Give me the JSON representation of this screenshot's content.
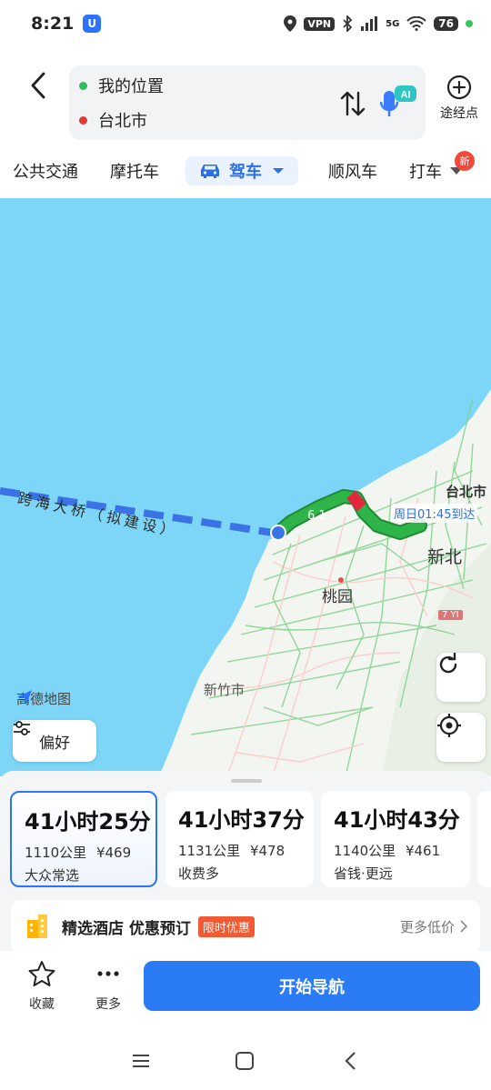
{
  "status_bar": {
    "time": "8:21",
    "app_badge": "U",
    "vpn": "VPN",
    "network": "5G",
    "battery": "76"
  },
  "header": {
    "origin": "我的位置",
    "destination": "台北市",
    "ai_label": "AI",
    "waypoint_label": "途经点"
  },
  "tabs": {
    "items": [
      "公共交通",
      "摩托车",
      "驾车",
      "顺风车",
      "打车"
    ],
    "active": "驾车",
    "new_badge": "新"
  },
  "map": {
    "bridge_label": "跨海大桥（拟建设）",
    "route_number": "6 1",
    "eta": "周日01:45到达",
    "cities": {
      "taipei": "台北市",
      "xinbei": "新北",
      "taoyuan": "桃园",
      "xinzhu": "新竹市"
    },
    "road_sign": "7 YI",
    "logo": "高德地图",
    "preference_button": "偏好",
    "colors": {
      "sea": "#7dd6f7",
      "route": "#2fb44a",
      "route_congested": "#e2283c",
      "bridge": "#3b73e6"
    }
  },
  "routes": [
    {
      "duration": "41小时25分",
      "distance": "1110公里",
      "cost": "¥469",
      "tag": "大众常选",
      "selected": true
    },
    {
      "duration": "41小时37分",
      "distance": "1131公里",
      "cost": "¥478",
      "tag": "收费多",
      "selected": false
    },
    {
      "duration": "41小时43分",
      "distance": "1140公里",
      "cost": "¥461",
      "tag": "省钱·更远",
      "selected": false
    }
  ],
  "hotel": {
    "title": "精选酒店 优惠预订",
    "badge": "限时优惠",
    "more": "更多低价"
  },
  "actions": {
    "favorite": "收藏",
    "more": "更多",
    "start": "开始导航"
  }
}
